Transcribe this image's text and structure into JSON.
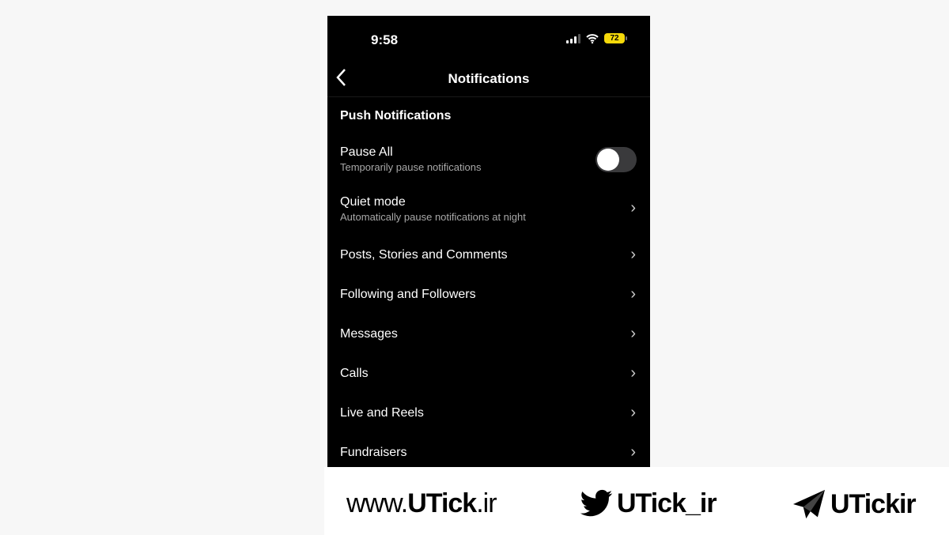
{
  "status_bar": {
    "time": "9:58",
    "battery": "72",
    "battery_color": "#f5d90a"
  },
  "header": {
    "title": "Notifications",
    "back_icon": "chevron-left-icon"
  },
  "section_title": "Push Notifications",
  "pause_all": {
    "label": "Pause All",
    "sub": "Temporarily pause notifications",
    "enabled": false
  },
  "quiet_mode": {
    "label": "Quiet mode",
    "sub": "Automatically pause notifications at night"
  },
  "items": [
    {
      "label": "Posts, Stories and Comments"
    },
    {
      "label": "Following and Followers"
    },
    {
      "label": "Messages"
    },
    {
      "label": "Calls"
    },
    {
      "label": "Live and Reels"
    },
    {
      "label": "Fundraisers"
    }
  ],
  "footer": {
    "website_prefix": "www.",
    "website_brand": "UTick",
    "website_suffix": ".ir",
    "twitter": "UTick_ir",
    "telegram": "UTickir"
  }
}
